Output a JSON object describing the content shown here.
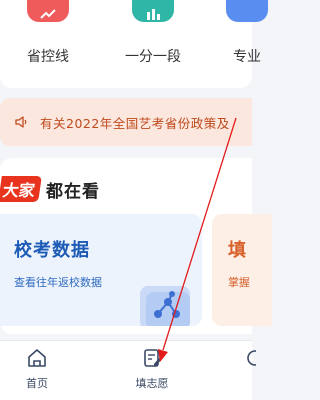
{
  "quick_entries": [
    {
      "label": "省控线",
      "icon": "chart-trend-icon",
      "color": "#ef5a5a"
    },
    {
      "label": "一分一段",
      "icon": "bar-chart-icon",
      "color": "#2fb6a6"
    },
    {
      "label": "专业",
      "icon": "book-icon",
      "color": "#5a8df0"
    }
  ],
  "notice": {
    "icon": "speaker-icon",
    "text": "有关2022年全国艺考省份政策及"
  },
  "section": {
    "brand_tag": "大家",
    "brand_rest": "都在看",
    "cards": [
      {
        "title": "校考数据",
        "subtitle": "查看往年返校数据",
        "illus_icon": "data-network-icon"
      },
      {
        "title": "填",
        "subtitle": "掌握"
      }
    ]
  },
  "tabbar": {
    "items": [
      {
        "label": "首页",
        "icon": "home-icon"
      },
      {
        "label": "填志愿",
        "icon": "form-edit-icon"
      }
    ]
  },
  "colors": {
    "accent_blue": "#1d5bb6",
    "notice_text": "#c0491c",
    "brand_red": "#e8341f",
    "pointer_arrow": "#e21b1b"
  }
}
